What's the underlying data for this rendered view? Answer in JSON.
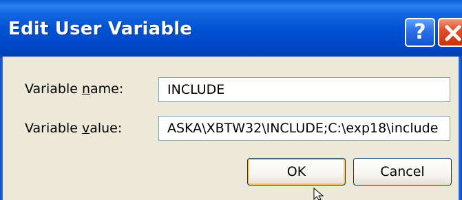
{
  "dialog": {
    "title": "Edit User Variable",
    "help_glyph": "?",
    "close_icon": "close-icon"
  },
  "fields": {
    "name": {
      "label_before": "Variable ",
      "label_accel": "n",
      "label_after": "ame:",
      "value": "INCLUDE"
    },
    "value": {
      "label_before": "Variable ",
      "label_accel": "v",
      "label_after": "alue:",
      "value": "ASKA\\XBTW32\\INCLUDE;C:\\exp18\\include"
    }
  },
  "buttons": {
    "ok": "OK",
    "cancel": "Cancel"
  },
  "colors": {
    "titlebar": "#0053d4",
    "face": "#ece9d8",
    "close": "#e0512a",
    "field_border": "#7f9db9",
    "button_border": "#003c74"
  },
  "icons": [
    "help-icon",
    "close-icon",
    "mouse-pointer-icon"
  ]
}
